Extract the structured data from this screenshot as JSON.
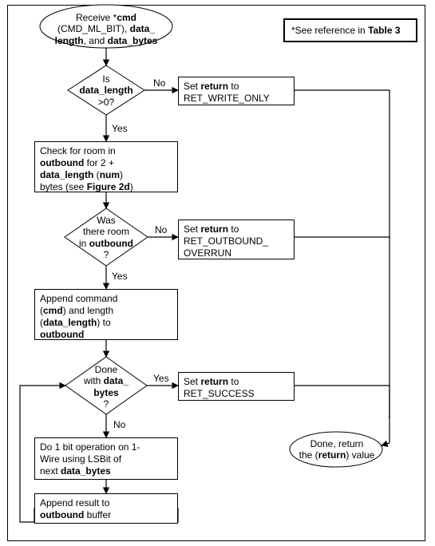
{
  "note": {
    "prefix": "*See reference in ",
    "bold": "Table 3"
  },
  "start": {
    "l1a": "Receive *",
    "l1b": "cmd",
    "l2a": "(CMD_ML_BIT),  ",
    "l2b": "data_",
    "l3a": "length",
    "l3b": ", and ",
    "l3c": "data_bytes"
  },
  "d1": {
    "l1": "Is",
    "l2": "data_length",
    "l3": ">0?"
  },
  "d1_no": "No",
  "d1_yes": "Yes",
  "p1": {
    "l1a": "Set ",
    "l1b": "return",
    "l1c": " to",
    "l2": "RET_WRITE_ONLY"
  },
  "p2": {
    "l1": "Check for room in",
    "l2a": "outbound",
    "l2b": " for 2 +",
    "l3a": "data_length",
    "l3mid": " (",
    "l3b": "num",
    "l3c": ")",
    "l4a": "bytes  (see ",
    "l4b": "Figure 2d",
    "l4c": ")"
  },
  "d2": {
    "l1": "Was",
    "l2": "there room",
    "l3a": "in ",
    "l3b": "outbound",
    "l4": "?"
  },
  "d2_no": "No",
  "d2_yes": "Yes",
  "p3": {
    "l1a": "Set ",
    "l1b": "return",
    "l1c": " to",
    "l2": "RET_OUTBOUND_",
    "l3": "OVERRUN"
  },
  "p4": {
    "l1": "Append command",
    "l2a": "(",
    "l2b": "cmd",
    "l2c": ") and length",
    "l3a": "(",
    "l3b": "data_length",
    "l3c": ") to",
    "l4": "outbound"
  },
  "d3": {
    "l1": "Done",
    "l2a": "with ",
    "l2b": "data_",
    "l3": "bytes",
    "l4": "?"
  },
  "d3_yes": "Yes",
  "d3_no": "No",
  "p5": {
    "l1a": "Set ",
    "l1b": "return",
    "l1c": " to",
    "l2": "RET_SUCCESS"
  },
  "p6": {
    "l1": "Do 1 bit operation on 1-",
    "l2": "Wire using LSBit of",
    "l3a": "next ",
    "l3b": "data_bytes"
  },
  "p7": {
    "l1": "Append result to",
    "l2a": "outbound",
    "l2b": " buffer"
  },
  "end": {
    "l1": "Done, return",
    "l2a": "the (",
    "l2b": "return",
    "l2c": ") value"
  },
  "chart_data": {
    "type": "flowchart",
    "nodes": [
      {
        "id": "start",
        "kind": "terminator",
        "text": "Receive *cmd (CMD_ML_BIT), data_length, and data_bytes"
      },
      {
        "id": "d1",
        "kind": "decision",
        "text": "Is data_length >0?"
      },
      {
        "id": "p1",
        "kind": "process",
        "text": "Set return to RET_WRITE_ONLY"
      },
      {
        "id": "p2",
        "kind": "process",
        "text": "Check for room in outbound for 2 + data_length (num) bytes (see Figure 2d)"
      },
      {
        "id": "d2",
        "kind": "decision",
        "text": "Was there room in outbound ?"
      },
      {
        "id": "p3",
        "kind": "process",
        "text": "Set return to RET_OUTBOUND_OVERRUN"
      },
      {
        "id": "p4",
        "kind": "process",
        "text": "Append command (cmd) and length (data_length) to outbound"
      },
      {
        "id": "d3",
        "kind": "decision",
        "text": "Done with data_bytes ?"
      },
      {
        "id": "p5",
        "kind": "process",
        "text": "Set return to RET_SUCCESS"
      },
      {
        "id": "p6",
        "kind": "process",
        "text": "Do 1 bit operation on 1-Wire using LSBit of next data_bytes"
      },
      {
        "id": "p7",
        "kind": "process",
        "text": "Append result to outbound buffer"
      },
      {
        "id": "end",
        "kind": "terminator",
        "text": "Done, return the (return) value"
      }
    ],
    "edges": [
      {
        "from": "start",
        "to": "d1"
      },
      {
        "from": "d1",
        "to": "p1",
        "label": "No"
      },
      {
        "from": "d1",
        "to": "p2",
        "label": "Yes"
      },
      {
        "from": "p1",
        "to": "end"
      },
      {
        "from": "p2",
        "to": "d2"
      },
      {
        "from": "d2",
        "to": "p3",
        "label": "No"
      },
      {
        "from": "d2",
        "to": "p4",
        "label": "Yes"
      },
      {
        "from": "p3",
        "to": "end"
      },
      {
        "from": "p4",
        "to": "d3"
      },
      {
        "from": "d3",
        "to": "p5",
        "label": "Yes"
      },
      {
        "from": "d3",
        "to": "p6",
        "label": "No"
      },
      {
        "from": "p5",
        "to": "end"
      },
      {
        "from": "p6",
        "to": "p7"
      },
      {
        "from": "p7",
        "to": "d3",
        "note": "loop back"
      }
    ],
    "note": "*See reference in Table 3"
  }
}
